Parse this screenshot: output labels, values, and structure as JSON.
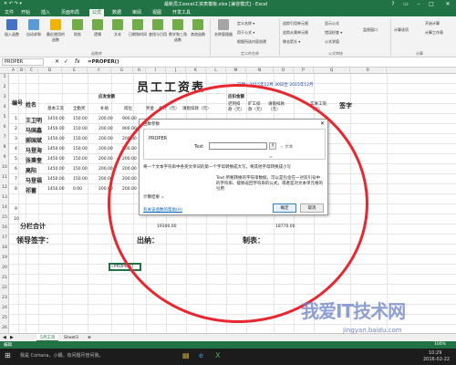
{
  "window": {
    "title": "最新员工excel工资表模板.xlsx  [兼容模式] - Excel",
    "quick_access": "✕ ↶ ↷ ▾",
    "controls": [
      "?",
      "▭",
      "–",
      "□",
      "✕"
    ]
  },
  "tabs": [
    "文件",
    "开始",
    "插入",
    "页面布局",
    "公式",
    "数据",
    "审阅",
    "视图",
    "开发工具"
  ],
  "active_tab": "公式",
  "ribbon": {
    "buttons": [
      {
        "label": "插入函数",
        "icon": "fx-icon",
        "color": "#4472c4"
      },
      {
        "label": "自动求和",
        "icon": "sigma-icon",
        "color": "#5b9bd5"
      },
      {
        "label": "最近使用的函数",
        "icon": "star-icon",
        "color": "#f0b400"
      },
      {
        "label": "财务",
        "icon": "book-icon",
        "color": "#70ad47"
      },
      {
        "label": "逻辑",
        "icon": "book-icon",
        "color": "#70ad47"
      },
      {
        "label": "文本",
        "icon": "book-icon",
        "color": "#70ad47"
      },
      {
        "label": "日期和时间",
        "icon": "book-icon",
        "color": "#70ad47"
      },
      {
        "label": "查找与引用",
        "icon": "book-icon",
        "color": "#70ad47"
      },
      {
        "label": "数学和三角函数",
        "icon": "book-icon",
        "color": "#70ad47"
      },
      {
        "label": "其他函数",
        "icon": "book-icon",
        "color": "#70ad47"
      },
      {
        "label": "名称管理器",
        "icon": "tag-icon",
        "color": "#a5a5a5"
      }
    ],
    "small": [
      "定义名称 ▾",
      "用于公式 ▾",
      "根据所选内容创建",
      "追踪引用单元格",
      "追踪从属单元格",
      "移去箭头 ▾",
      "显示公式",
      "错误检查 ▾",
      "公式求值",
      "监视窗口",
      "计算选项",
      "开始计算",
      "计算工作表"
    ],
    "groups": [
      "函数库",
      "定义的名称",
      "公式审核",
      "计算"
    ]
  },
  "formula_bar": {
    "name_box": "PROPER",
    "cancel": "✕",
    "enter": "✓",
    "fx": "fx",
    "formula": "=PROPER()"
  },
  "columns": [
    "A",
    "B",
    "C",
    "D",
    "E",
    "F",
    "G",
    "H",
    "I",
    "J",
    "K",
    "L",
    "M",
    "N",
    "O",
    "P",
    "Q",
    "R"
  ],
  "rows": [
    "1",
    "2",
    "3",
    "4",
    "5",
    "6",
    "7",
    "8",
    "9",
    "10",
    "11",
    "12",
    "13",
    "14",
    "15",
    "16",
    "17",
    "18",
    "19",
    "20",
    "21",
    "22",
    "23",
    "24",
    "25",
    "26"
  ],
  "sheet": {
    "title": "员工工资表",
    "date_label": "日期：2015年12月 30日至 2015年12月",
    "headers": {
      "num": "编号",
      "name": "姓名",
      "should": "应发金额",
      "base": "基本工资",
      "full": "全勤奖",
      "subsidy": "补助",
      "post": "岗位",
      "bonus": "奖金",
      "total_should": "合计（元）",
      "deduct": "应扣金额",
      "late": "迟到扣款（元）",
      "absent": "旷工扣款（元）",
      "leave": "请假扣款（元）",
      "actual": "实发工资（元）",
      "sign": "签字",
      "deduct_total": "请假扣款（元）"
    },
    "employees": [
      {
        "no": "1",
        "name": "王卫明",
        "base": "1450.00",
        "full": "150.00",
        "subsidy": "200.00",
        "post": "900.00"
      },
      {
        "no": "2",
        "name": "马国鑫",
        "base": "1450.00",
        "full": "150.00",
        "subsidy": "200.00",
        "post": "900.00"
      },
      {
        "no": "3",
        "name": "郝国斌",
        "base": "1450.00",
        "full": "150.00",
        "subsidy": "200.00",
        "post": "200.00"
      },
      {
        "no": "4",
        "name": "马登海",
        "base": "1450.00",
        "full": "150.00",
        "subsidy": "200.00",
        "post": "500.00"
      },
      {
        "no": "5",
        "name": "张秉奎",
        "base": "1450.00",
        "full": "150.00",
        "subsidy": "200.00",
        "post": "200.00"
      },
      {
        "no": "6",
        "name": "高阳",
        "base": "1450.00",
        "full": "150.00",
        "subsidy": "200.00",
        "post": "200.00"
      },
      {
        "no": "7",
        "name": "马登福",
        "base": "1450.00",
        "full": "150.00",
        "subsidy": "200.00",
        "post": "200.00"
      },
      {
        "no": "8",
        "name": "祁蓄",
        "base": "1450.00",
        "full": "0.00",
        "subsidy": "200.00",
        "post": "200.00"
      }
    ],
    "extra_rows": [
      "9",
      "10"
    ],
    "total_label": "分栏合计",
    "total_should": "19300.00",
    "total_actual": "18770.00",
    "footer": {
      "leader": "领导签字：",
      "cashier": "出纳：",
      "maker": "制表："
    },
    "active_cell": "=PROPER()"
  },
  "dialog": {
    "title": "函数参数",
    "close": "✕",
    "function_name": "PROPER",
    "arg_label": "Text",
    "arg_value": "",
    "arg_result": "= 文本",
    "result_eq": "=",
    "description": "将一个文本字符串中各英文单词的第一个字母转换成大写，将其他字母转换成小写",
    "arg_desc": "Text  所要转换的字符串数据，可以是包含在一对双引号中的字符串、能够返回字符串的公式，或者是对文本单元格的引用",
    "calc_result": "计算结果 =",
    "help_link": "有关该函数的帮助(H)",
    "ok": "确定",
    "cancel": "取消"
  },
  "sheet_tabs": [
    "5月工资",
    "Sheet3",
    "⊕"
  ],
  "active_sheet_tab": "5月工资",
  "status": {
    "left": "编辑",
    "zoom": "100%"
  },
  "taskbar": {
    "search": "我是 Cortana，小娜。有问题尽管问我。",
    "time": "10:29",
    "date": "2016-02-22"
  },
  "watermark": {
    "main": "我爱IT技术网",
    "url": "jingyan.baidu.com"
  },
  "colors": {
    "excel_green": "#217346",
    "annotation_red": "#e8262f"
  }
}
